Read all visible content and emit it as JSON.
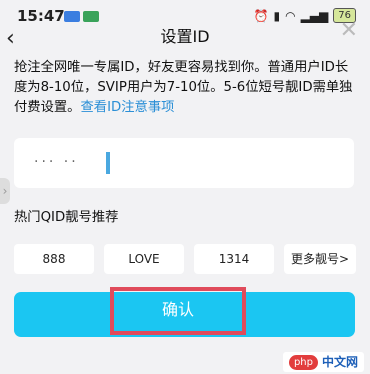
{
  "status_bar": {
    "time": "15:47",
    "battery": "76"
  },
  "header": {
    "title": "设置ID"
  },
  "description": {
    "text": "抢注全网唯一专属ID，好友更容易找到你。普通用户ID长度为8-10位，SVIP用户为7-10位。5-6位短号靓ID需单独付费设置。",
    "link": "查看ID注意事项"
  },
  "id_input": {
    "value": "··· ··"
  },
  "section": {
    "label": "热门QID靓号推荐"
  },
  "chips": [
    "888",
    "LOVE",
    "1314",
    "更多靓号>"
  ],
  "confirm": {
    "label": "确认"
  },
  "watermark": {
    "badge": "php",
    "text": "中文网"
  },
  "colors": {
    "accent": "#1bc6f2",
    "link": "#2b8fd6",
    "highlight_box": "#e04b5b"
  }
}
